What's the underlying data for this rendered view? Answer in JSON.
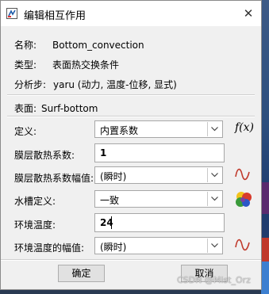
{
  "dialog": {
    "title": "编辑相互作用",
    "close_glyph": "✕"
  },
  "info": {
    "name_label": "名称:",
    "name_value": "Bottom_convection",
    "type_label": "类型:",
    "type_value": "表面热交换条件",
    "step_label": "分析步:",
    "step_value": "yaru (动力, 温度-位移, 显式)"
  },
  "surface": {
    "label": "表面:",
    "value": "Surf-bottom"
  },
  "form": {
    "definition": {
      "label": "定义:",
      "value": "内置系数",
      "icon": "function-fx-icon"
    },
    "film_coeff": {
      "label": "膜层散热系数:",
      "value": "1"
    },
    "film_amplitude": {
      "label": "膜层散热系数幅值:",
      "value": "(瞬时)",
      "icon": "amplitude-wave-icon"
    },
    "sink_definition": {
      "label": "水槽定义:",
      "value": "一致",
      "icon": "color-spheres-icon"
    },
    "sink_temperature": {
      "label": "环境温度:",
      "value": "24"
    },
    "sink_amplitude": {
      "label": "环境温度的幅值:",
      "value": "(瞬时)",
      "icon": "amplitude-wave-icon"
    }
  },
  "buttons": {
    "ok": "确定",
    "cancel": "取消"
  },
  "fx_text": "f(x)",
  "watermark": "CSDN @Mist_Orz",
  "colors": {
    "wave": "#c0392b",
    "dialog_bg": "#f0f0f0"
  }
}
